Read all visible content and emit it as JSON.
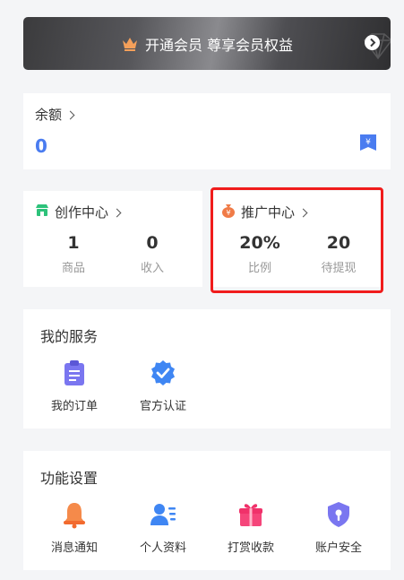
{
  "vip": {
    "text": "开通会员 尊享会员权益"
  },
  "balance": {
    "label": "余额",
    "value": "0"
  },
  "creation_center": {
    "title": "创作中心",
    "stats": [
      {
        "value": "1",
        "label": "商品"
      },
      {
        "value": "0",
        "label": "收入"
      }
    ]
  },
  "promotion_center": {
    "title": "推广中心",
    "stats": [
      {
        "value": "20%",
        "label": "比例"
      },
      {
        "value": "20",
        "label": "待提现"
      }
    ]
  },
  "my_services": {
    "title": "我的服务",
    "items": [
      {
        "label": "我的订单",
        "icon": "clipboard-icon"
      },
      {
        "label": "官方认证",
        "icon": "verified-badge-icon"
      }
    ]
  },
  "settings": {
    "title": "功能设置",
    "items": [
      {
        "label": "消息通知",
        "icon": "bell-icon"
      },
      {
        "label": "个人资料",
        "icon": "profile-card-icon"
      },
      {
        "label": "打赏收款",
        "icon": "gift-icon"
      },
      {
        "label": "账户安全",
        "icon": "shield-icon"
      }
    ]
  },
  "colors": {
    "accent_blue": "#4a7cf0",
    "highlight_red": "#f01c1c",
    "vip_orange": "#f5a05a"
  }
}
